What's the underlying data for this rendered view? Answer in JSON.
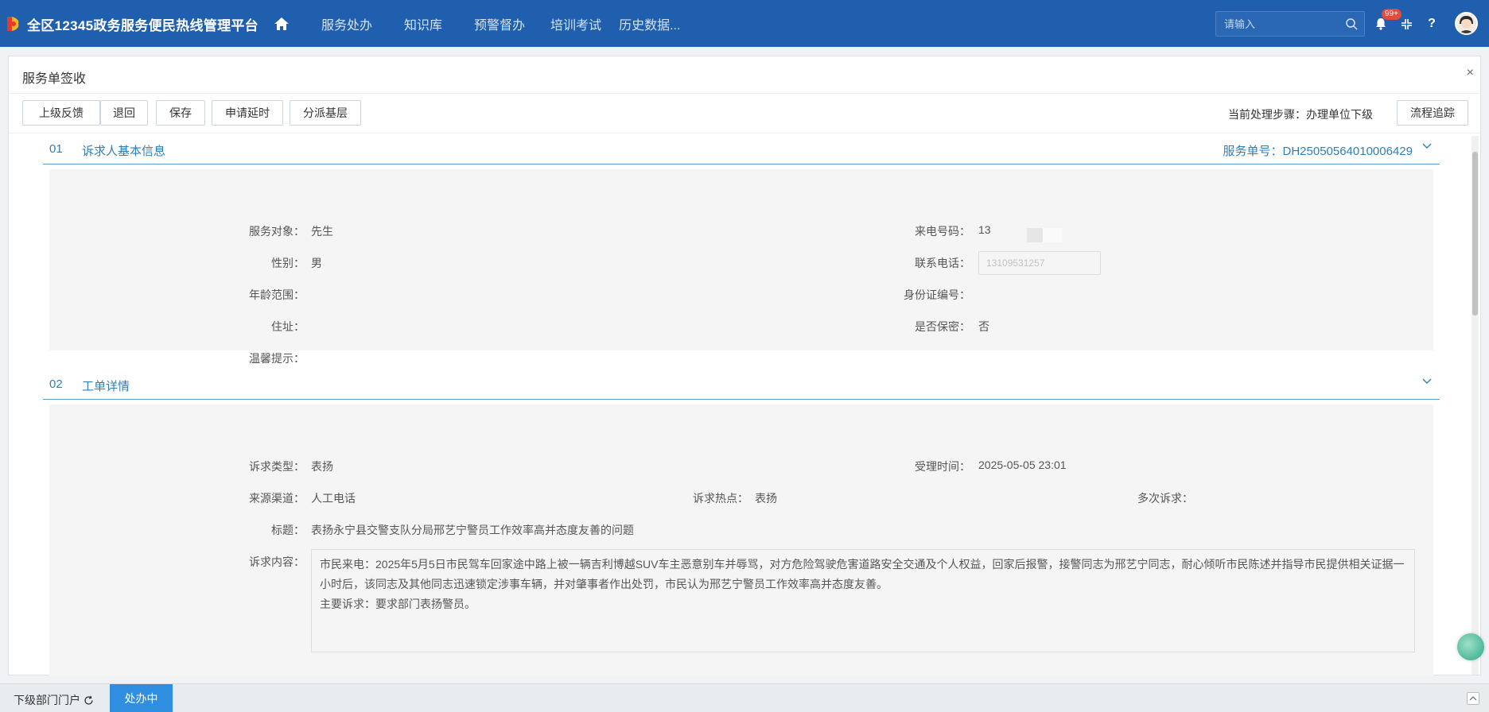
{
  "header": {
    "app_title": "全区12345政务服务便民热线管理平台",
    "nav": [
      "服务处办",
      "知识库",
      "预警督办",
      "培训考试",
      "历史数据..."
    ],
    "search_placeholder": "请输入",
    "notification_badge": "99+",
    "help_label": "?"
  },
  "modal": {
    "title": "服务单签收",
    "close_label": "×",
    "toolbar": {
      "buttons": [
        "上级反馈",
        "退回",
        "保存",
        "申请延时",
        "分派基层"
      ],
      "current_step_label": "当前处理步骤：办理单位下级",
      "trace_button": "流程追踪"
    },
    "section1": {
      "num": "01",
      "title": "诉求人基本信息",
      "service_no": "服务单号：DH2505056401000642​9",
      "fields": {
        "service_target_label": "服务对象：",
        "service_target_value": "先生",
        "caller_number_label": "来电号码：",
        "caller_number_value": "13",
        "gender_label": "性别：",
        "gender_value": "男",
        "contact_phone_label": "联系电话：",
        "contact_phone_value": "13109531257",
        "age_range_label": "年龄范围：",
        "id_number_label": "身份证编号：",
        "address_label": "住址：",
        "confidential_label": "是否保密：",
        "confidential_value": "否",
        "tips_label": "温馨提示："
      }
    },
    "section2": {
      "num": "02",
      "title": "工单详情",
      "fields": {
        "type_label": "诉求类型：",
        "type_value": "表扬",
        "accept_time_label": "受理时间：",
        "accept_time_value": "2025-05-05 23:01",
        "channel_label": "来源渠道：",
        "channel_value": "人工电话",
        "hotspot_label": "诉求热点：",
        "hotspot_value": "表扬",
        "multiple_label": "多次诉求：",
        "subject_label": "标题：",
        "subject_value": "表扬永宁县交警支队分局邢艺宁警员工作效率高并态度友善的问题",
        "content_label": "诉求内容：",
        "content_line1": "市民来电：2025年5月5日市民驾车回家途中路上被一辆吉利博越SUV车主恶意别车并辱骂，对方危险驾驶危害道路安全交通及个人权益，回家后报警，接警同志为邢艺宁同志，耐心倾听市民陈述并指导市民提供相关证据一",
        "content_line2": "小时后，该同志及其他同志迅速锁定涉事车辆，并对肇事者作出处罚，市民认为邢艺宁警员工作效率高并态度友善。",
        "content_line3": "主要诉求：要求部门表扬警员。"
      }
    }
  },
  "bottom": {
    "lower_portal": "下级部门门户",
    "processing": "处办中"
  },
  "colors": {
    "topbar": "#1f5fae",
    "section_accent": "#2f7fb4",
    "active_tab": "#2f8ee0"
  },
  "icons": [
    "home-icon",
    "search-icon",
    "bell-icon",
    "fullscreen-icon",
    "help-icon",
    "avatar",
    "close-icon",
    "chevron-down-icon",
    "refresh-icon",
    "chevron-up-icon"
  ]
}
